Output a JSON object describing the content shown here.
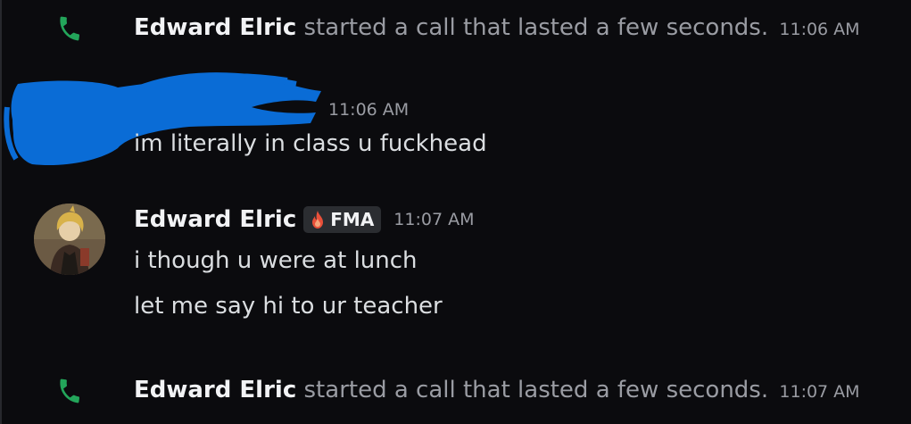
{
  "messages": {
    "call_1": {
      "author": "Edward Elric",
      "text": "started a call that lasted a few seconds.",
      "time": "11:06 AM"
    },
    "redacted_message": {
      "time": "11:06 AM",
      "text": "im literally in class u fuckhead"
    },
    "edward_message": {
      "author": "Edward Elric",
      "tag": "FMA",
      "time": "11:07 AM",
      "lines": [
        "i though u were at lunch",
        "let me say hi to ur teacher"
      ]
    },
    "call_2": {
      "author": "Edward Elric",
      "text": "started a call that lasted a few seconds.",
      "time": "11:07 AM"
    }
  },
  "colors": {
    "background": "#0b0b0e",
    "phone_icon": "#23a55a",
    "redaction": "#0a6cd6",
    "tag_background": "#2b2d31",
    "tag_flame": "#e8503a"
  },
  "icons": {
    "call": "phone-icon",
    "tag": "flame-icon"
  }
}
